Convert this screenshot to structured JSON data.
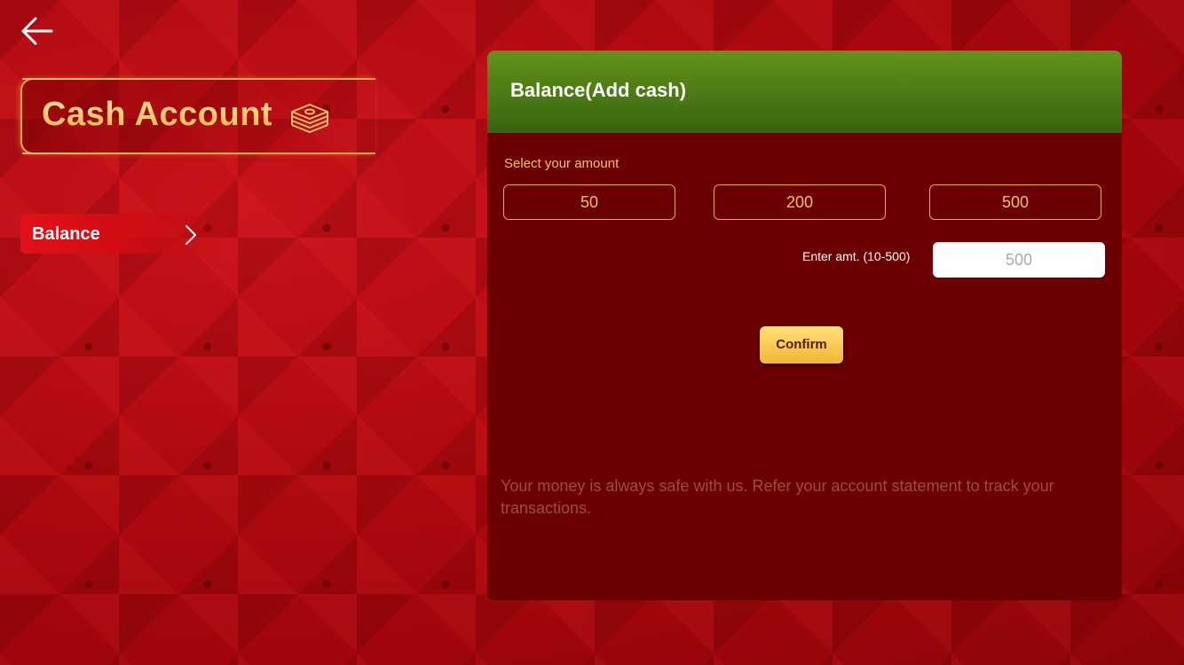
{
  "nav": {
    "back_icon": "arrow-left-icon"
  },
  "sidebar": {
    "title": "Cash Account",
    "title_icon": "cash-stack-icon",
    "items": [
      {
        "label": "Balance",
        "icon": "chevron-right-icon"
      }
    ]
  },
  "panel": {
    "title": "Balance(Add cash)",
    "select_label": "Select your amount",
    "amounts": [
      "50",
      "200",
      "500"
    ],
    "enter_label": "Enter amt. (10-500)",
    "input_placeholder": "500",
    "input_value": "",
    "confirm_label": "Confirm",
    "note": "Your money is always safe with us. Refer your account statement to track your transactions."
  },
  "colors": {
    "background": "#b8090f",
    "panel_bg": "#6b0000",
    "header_green": "#4f7d15",
    "accent_gold": "#f3c26a",
    "confirm_gold": "#f2b733"
  }
}
